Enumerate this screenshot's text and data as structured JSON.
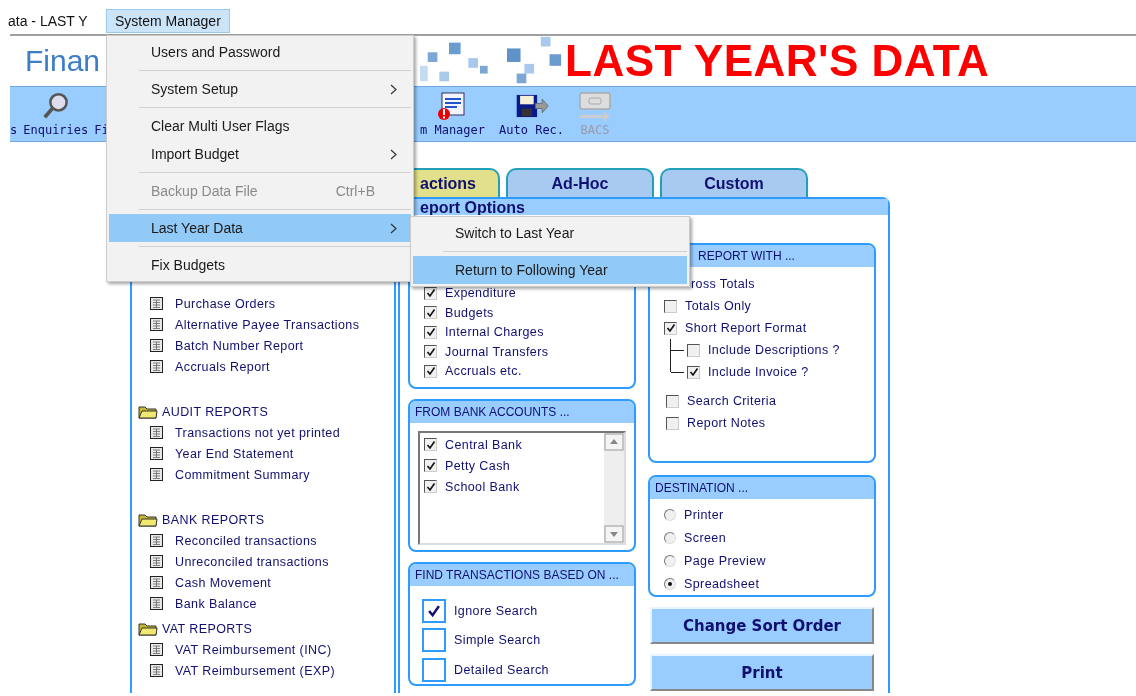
{
  "title_bar": {
    "title": "ata - LAST Y"
  },
  "menu_bar": [
    {
      "label": "System Manager",
      "selected": true
    }
  ],
  "header": {
    "app_name": "Finan",
    "banner": "LAST YEAR'S DATA"
  },
  "toolbar_left": [
    {
      "label": "s",
      "kind": "none",
      "disabled": false
    },
    {
      "label": "Enquiries",
      "kind": "search",
      "disabled": false
    },
    {
      "label": "Fi",
      "kind": "none",
      "disabled": false
    }
  ],
  "toolbar_right": [
    {
      "label": "m Manager",
      "kind": "manager",
      "disabled": false
    },
    {
      "label": "Auto Rec.",
      "kind": "disk",
      "disabled": false
    },
    {
      "label": "BACS",
      "kind": "card",
      "disabled": true
    }
  ],
  "tabs": [
    {
      "label": "actions",
      "selected": true
    },
    {
      "label": "Ad-Hoc",
      "selected": false
    },
    {
      "label": "Custom",
      "selected": false
    }
  ],
  "report_list": [
    {
      "items": [
        "Purchase Orders",
        "Alternative Payee Transactions",
        "Batch Number Report",
        "Accruals Report"
      ]
    },
    {
      "title": "AUDIT REPORTS",
      "items": [
        "Transactions not yet printed",
        "Year End Statement",
        "Commitment Summary"
      ]
    },
    {
      "title": "BANK REPORTS",
      "items": [
        "Reconciled transactions",
        "Unreconciled transactions",
        "Cash Movement",
        "Bank Balance"
      ]
    },
    {
      "title": "VAT  REPORTS",
      "items": [
        "VAT  Reimbursement (INC)",
        "VAT  Reimbursement (EXP)"
      ]
    }
  ],
  "report_options": {
    "title": "eport Options",
    "transaction_types": [
      {
        "label": "Expenditure",
        "checked": true
      },
      {
        "label": "Budgets",
        "checked": true
      },
      {
        "label": "Internal Charges",
        "checked": true
      },
      {
        "label": "Journal Transfers",
        "checked": true
      },
      {
        "label": "Accruals etc.",
        "checked": true
      }
    ],
    "bank_accounts": {
      "title": "FROM BANK ACCOUNTS ...",
      "items": [
        {
          "label": "Central Bank",
          "checked": true
        },
        {
          "label": "Petty Cash",
          "checked": true
        },
        {
          "label": "School Bank",
          "checked": true
        }
      ]
    },
    "find_transactions": {
      "title": "FIND TRANSACTIONS BASED ON ...",
      "items": [
        {
          "label": "Ignore Search",
          "checked": true
        },
        {
          "label": "Simple Search",
          "checked": false
        },
        {
          "label": "Detailed Search",
          "checked": false
        }
      ]
    },
    "report_with": {
      "title": "REPORT WITH ...",
      "options": [
        {
          "kind": "partial",
          "label": "ross Totals"
        },
        {
          "kind": "checkbox",
          "label": "Totals Only",
          "checked": false
        },
        {
          "kind": "checkbox",
          "label": "Short Report Format",
          "checked": true,
          "children": [
            {
              "kind": "checkbox",
              "label": "Include Descriptions ?",
              "checked": false
            },
            {
              "kind": "checkbox",
              "label": "Include Invoice ?",
              "checked": true
            }
          ]
        }
      ],
      "extra_options": [
        {
          "label": "Search Criteria",
          "checked": false
        },
        {
          "label": "Report Notes",
          "checked": false
        }
      ]
    },
    "destination": {
      "title": "DESTINATION ...",
      "options": [
        {
          "label": "Printer",
          "selected": false
        },
        {
          "label": "Screen",
          "selected": false
        },
        {
          "label": "Page Preview",
          "selected": false
        },
        {
          "label": "Spreadsheet",
          "selected": true
        }
      ]
    },
    "buttons": [
      "Change Sort Order",
      "Print"
    ]
  },
  "system_menu": [
    {
      "kind": "item",
      "label": "Users and Password",
      "submenu": false,
      "disabled": false,
      "selected": false
    },
    {
      "kind": "separator"
    },
    {
      "kind": "item",
      "label": "System Setup",
      "submenu": true,
      "disabled": false,
      "selected": false
    },
    {
      "kind": "separator"
    },
    {
      "kind": "item",
      "label": "Clear Multi User Flags",
      "submenu": false,
      "disabled": false,
      "selected": false
    },
    {
      "kind": "item",
      "label": "Import Budget",
      "submenu": true,
      "disabled": false,
      "selected": false
    },
    {
      "kind": "separator"
    },
    {
      "kind": "item",
      "label": "Backup Data File",
      "shortcut": "Ctrl+B",
      "submenu": false,
      "disabled": true,
      "selected": false
    },
    {
      "kind": "separator"
    },
    {
      "kind": "item",
      "label": "Last Year Data",
      "submenu": true,
      "disabled": false,
      "selected": true
    },
    {
      "kind": "separator"
    },
    {
      "kind": "item",
      "label": "Fix Budgets",
      "submenu": false,
      "disabled": false,
      "selected": false
    }
  ],
  "last_year_submenu": [
    {
      "kind": "item",
      "label": "Switch to Last Year",
      "submenu": false,
      "disabled": false,
      "selected": false
    },
    {
      "kind": "separator"
    },
    {
      "kind": "item",
      "label": "Return to Following Year",
      "submenu": false,
      "disabled": false,
      "selected": true
    }
  ]
}
